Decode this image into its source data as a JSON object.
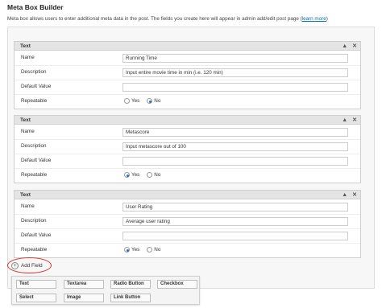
{
  "page": {
    "title": "Meta Box Builder",
    "description": "Meta box allows users to enter additional meta data in the post. The fields you create here will appear in admin add/edit post page (",
    "learn_more": "learn more",
    "description_end": ")"
  },
  "labels": {
    "name": "Name",
    "description": "Description",
    "default_value": "Default Value",
    "repeatable": "Repeatable",
    "yes": "Yes",
    "no": "No"
  },
  "fields": [
    {
      "type": "Text",
      "name": "Running Time",
      "description": "Input entire movie time in min (i.e. 120 min)",
      "default_value": "",
      "repeatable": "No"
    },
    {
      "type": "Text",
      "name": "Metascore",
      "description": "Input metascore out of 100",
      "default_value": "",
      "repeatable": "Yes"
    },
    {
      "type": "Text",
      "name": "User Rating",
      "description": "Average user rating",
      "default_value": "",
      "repeatable": "Yes"
    }
  ],
  "add_field": {
    "label": "Add Field"
  },
  "field_types": [
    "Text",
    "Textarea",
    "Radio Button",
    "Checkbox",
    "Select",
    "Image",
    "Link Button"
  ],
  "icons": {
    "collapse": "chevron-up-icon",
    "remove": "close-icon",
    "add": "plus-circle-icon"
  },
  "colors": {
    "highlight": "#d8322e",
    "link": "#0073aa",
    "radio_selected": "#1e73be"
  }
}
